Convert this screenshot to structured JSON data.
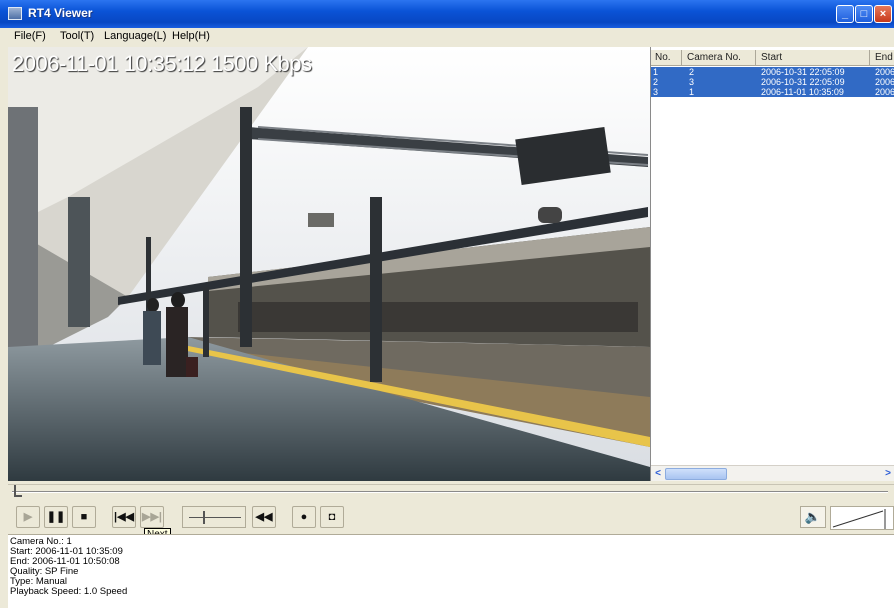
{
  "window": {
    "title": "RT4 Viewer"
  },
  "menu": {
    "file": "File(F)",
    "tool": "Tool(T)",
    "language": "Language(L)",
    "help": "Help(H)"
  },
  "video": {
    "osd": "2006-11-01 10:35:12  1500 Kbps"
  },
  "list": {
    "columns": {
      "no": "No.",
      "camera": "Camera No.",
      "start": "Start",
      "end": "End"
    },
    "rows": [
      {
        "no": "1",
        "camera": "2",
        "start": "2006-10-31 22:05:09",
        "end": "2006"
      },
      {
        "no": "2",
        "camera": "3",
        "start": "2006-10-31 22:05:09",
        "end": "2006"
      },
      {
        "no": "3",
        "camera": "1",
        "start": "2006-11-01 10:35:09",
        "end": "2006"
      }
    ]
  },
  "controls": {
    "tooltip": "Next"
  },
  "info": {
    "camera": "Camera No.: 1",
    "start": "Start: 2006-11-01 10:35:09",
    "end": "End: 2006-11-01 10:50:08",
    "quality": "Quality: SP Fine",
    "type": "Type: Manual",
    "speed": "Playback Speed: 1.0  Speed"
  },
  "colors": {
    "titlebar": "#0a53d6",
    "selection": "#316ac5",
    "window": "#ece9d8"
  }
}
